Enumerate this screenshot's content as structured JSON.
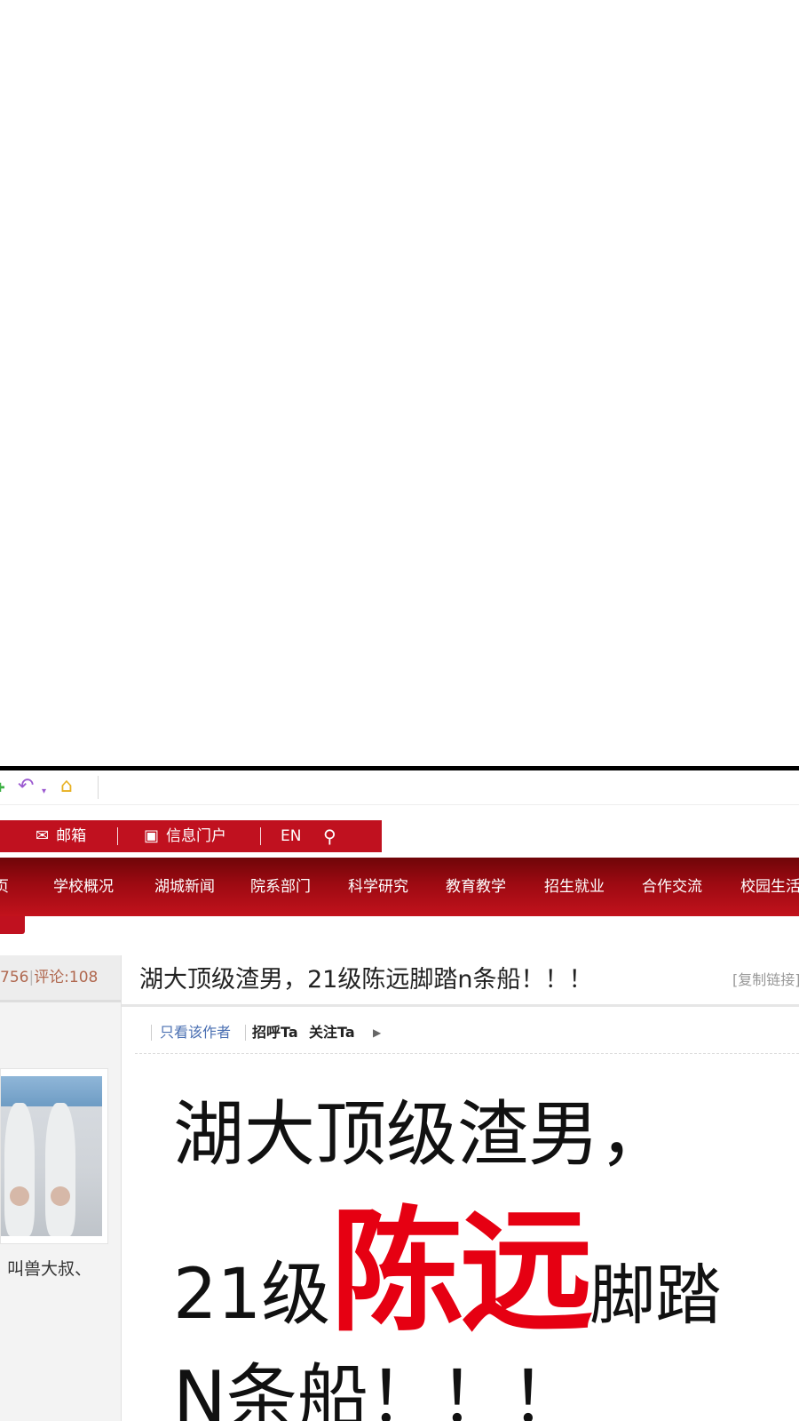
{
  "toolbar": {
    "icons": [
      "add-icon",
      "undo-icon",
      "dropdown-caret-icon",
      "home-icon"
    ]
  },
  "top_links": {
    "mail": "邮箱",
    "portal": "信息门户",
    "language": "EN"
  },
  "nav": {
    "items": [
      "首页",
      "学校概况",
      "湖城新闻",
      "院系部门",
      "科学研究",
      "教育教学",
      "招生就业",
      "合作交流",
      "校园生活"
    ]
  },
  "sidebar": {
    "stats_views": "756",
    "stats_comments": "评论:108",
    "username": "叫兽大叔、"
  },
  "post": {
    "title": "湖大顶级渣男，21级陈远脚踏n条船！！！",
    "copy_link": "[复制链接]"
  },
  "author_bar": {
    "only_author": "只看该作者",
    "greet": "招呼Ta",
    "follow": "关注Ta"
  },
  "poster": {
    "line1": "湖大顶级渣男，",
    "line2_prefix": "21级",
    "line2_name": "陈远",
    "line2_suffix": "脚踏",
    "line3": "N条船！！！"
  },
  "colors": {
    "brand_red": "#c0111f",
    "nav_dark_red": "#6f0508",
    "poster_name_red": "#e60012",
    "link_blue": "#4a6fb2"
  }
}
